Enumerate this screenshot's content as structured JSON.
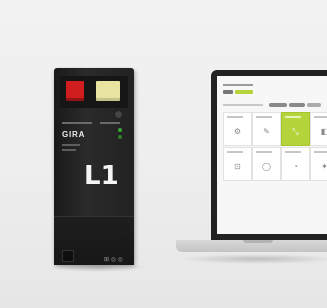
{
  "device": {
    "brand": "GIRA",
    "model_label": "L1",
    "port_icons": "⊞ ◎ ◎"
  },
  "laptop": {
    "ui_tiles": [
      {
        "icon": "⚙",
        "active": false
      },
      {
        "icon": "✎",
        "active": false
      },
      {
        "icon": "⤡",
        "active": true
      },
      {
        "icon": "◧",
        "active": false
      },
      {
        "icon": "⊡",
        "active": false
      },
      {
        "icon": "◯",
        "active": false
      },
      {
        "icon": "◔",
        "active": false
      },
      {
        "icon": "✦",
        "active": false
      }
    ]
  },
  "colors": {
    "accent_green": "#b5d33a",
    "terminal_red": "#d11d1d",
    "terminal_yellow": "#e9e3a2"
  }
}
